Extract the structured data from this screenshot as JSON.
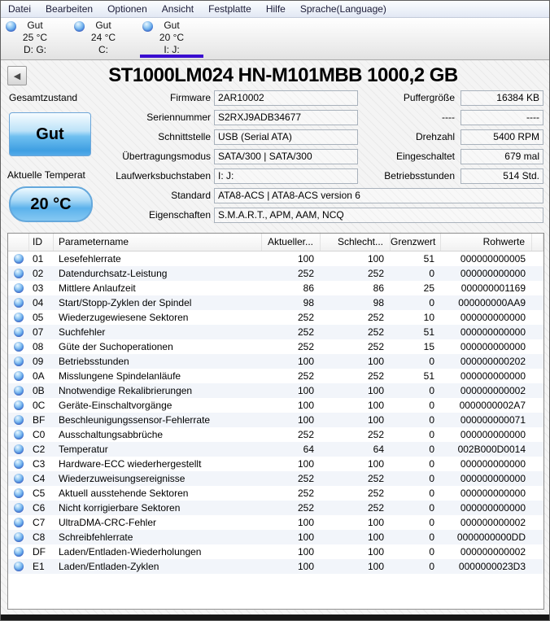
{
  "colors": {
    "accent_underline": "#3a0ed0",
    "health_blue": "#3f9fe2",
    "orb_blue": "#5aa2ea"
  },
  "menu": {
    "items": [
      "Datei",
      "Bearbeiten",
      "Optionen",
      "Ansicht",
      "Festplatte",
      "Hilfe",
      "Sprache(Language)"
    ]
  },
  "drive_tabs": [
    {
      "status": "Gut",
      "temperature": "25 °C",
      "letters": "D: G:",
      "selected": false
    },
    {
      "status": "Gut",
      "temperature": "24 °C",
      "letters": "C:",
      "selected": false
    },
    {
      "status": "Gut",
      "temperature": "20 °C",
      "letters": "I: J:",
      "selected": true
    }
  ],
  "header": {
    "title": "ST1000LM024 HN-M101MBB 1000,2 GB"
  },
  "info": {
    "health_label": "Gesamtzustand",
    "health_value": "Gut",
    "temp_label": "Aktuelle Temperat",
    "temp_value": "20 °C",
    "fields_left": [
      {
        "label": "Firmware",
        "value": "2AR10002"
      },
      {
        "label": "Seriennummer",
        "value": "S2RXJ9ADB34677"
      },
      {
        "label": "Schnittstelle",
        "value": "USB (Serial ATA)"
      },
      {
        "label": "Übertragungsmodus",
        "value": "SATA/300 | SATA/300"
      },
      {
        "label": "Laufwerksbuchstaben",
        "value": "I: J:"
      }
    ],
    "fields_right": [
      {
        "label": "Puffergröße",
        "value": "16384 KB"
      },
      {
        "label": "----",
        "value": "----"
      },
      {
        "label": "Drehzahl",
        "value": "5400 RPM"
      },
      {
        "label": "Eingeschaltet",
        "value": "679 mal"
      },
      {
        "label": "Betriebsstunden",
        "value": "514 Std."
      }
    ],
    "fields_wide": [
      {
        "label": "Standard",
        "value": "ATA8-ACS | ATA8-ACS version 6"
      },
      {
        "label": "Eigenschaften",
        "value": "S.M.A.R.T., APM, AAM, NCQ"
      }
    ]
  },
  "table": {
    "headers": [
      "",
      "ID",
      "Parametername",
      "Aktueller...",
      "Schlecht...",
      "Grenzwert",
      "Rohwerte"
    ],
    "rows": [
      [
        "01",
        "Lesefehlerrate",
        "100",
        "100",
        "51",
        "000000000005"
      ],
      [
        "02",
        "Datendurchsatz-Leistung",
        "252",
        "252",
        "0",
        "000000000000"
      ],
      [
        "03",
        "Mittlere Anlaufzeit",
        "86",
        "86",
        "25",
        "000000001169"
      ],
      [
        "04",
        "Start/Stopp-Zyklen der Spindel",
        "98",
        "98",
        "0",
        "000000000AA9"
      ],
      [
        "05",
        "Wiederzugewiesene Sektoren",
        "252",
        "252",
        "10",
        "000000000000"
      ],
      [
        "07",
        "Suchfehler",
        "252",
        "252",
        "51",
        "000000000000"
      ],
      [
        "08",
        "Güte der Suchoperationen",
        "252",
        "252",
        "15",
        "000000000000"
      ],
      [
        "09",
        "Betriebsstunden",
        "100",
        "100",
        "0",
        "000000000202"
      ],
      [
        "0A",
        "Misslungene Spindelanläufe",
        "252",
        "252",
        "51",
        "000000000000"
      ],
      [
        "0B",
        "Nnotwendige Rekalibrierungen",
        "100",
        "100",
        "0",
        "000000000002"
      ],
      [
        "0C",
        "Geräte-Einschaltvorgänge",
        "100",
        "100",
        "0",
        "0000000002A7"
      ],
      [
        "BF",
        "Beschleunigungssensor-Fehlerrate",
        "100",
        "100",
        "0",
        "000000000071"
      ],
      [
        "C0",
        "Ausschaltungsabbrüche",
        "252",
        "252",
        "0",
        "000000000000"
      ],
      [
        "C2",
        "Temperatur",
        "64",
        "64",
        "0",
        "002B000D0014"
      ],
      [
        "C3",
        "Hardware-ECC wiederhergestellt",
        "100",
        "100",
        "0",
        "000000000000"
      ],
      [
        "C4",
        "Wiederzuweisungsereignisse",
        "252",
        "252",
        "0",
        "000000000000"
      ],
      [
        "C5",
        "Aktuell ausstehende Sektoren",
        "252",
        "252",
        "0",
        "000000000000"
      ],
      [
        "C6",
        "Nicht korrigierbare Sektoren",
        "252",
        "252",
        "0",
        "000000000000"
      ],
      [
        "C7",
        "UltraDMA-CRC-Fehler",
        "100",
        "100",
        "0",
        "000000000002"
      ],
      [
        "C8",
        "Schreibfehlerrate",
        "100",
        "100",
        "0",
        "0000000000DD"
      ],
      [
        "DF",
        "Laden/Entladen-Wiederholungen",
        "100",
        "100",
        "0",
        "000000000002"
      ],
      [
        "E1",
        "Laden/Entladen-Zyklen",
        "100",
        "100",
        "0",
        "0000000023D3"
      ]
    ]
  }
}
